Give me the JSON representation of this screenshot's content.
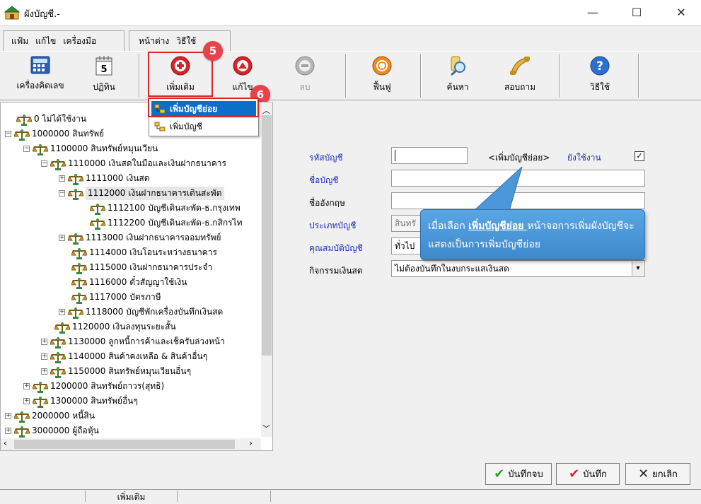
{
  "window": {
    "title": "ผังบัญชี.-",
    "controls": {
      "minimize": "—",
      "maximize": "☐",
      "close": "✕"
    }
  },
  "menu": {
    "group1": [
      "แฟ้ม",
      "แก้ไข",
      "เครื่องมือ"
    ],
    "group2": [
      "หน้าต่าง",
      "วิธีใช้"
    ]
  },
  "toolbar": {
    "calculator": "เครื่องคิดเลข",
    "calendar": "ปฏิทิน",
    "calendar_day": "5",
    "add": "เพิ่มเติม",
    "edit": "แก้ไข",
    "delete": "ลบ",
    "refresh": "ฟื้นฟู",
    "search": "ค้นหา",
    "inquiry": "สอบถาม",
    "help": "วิธีใช้"
  },
  "badges": {
    "step5": "5",
    "step6": "6"
  },
  "dropdown": {
    "items": [
      "เพิ่มบัญชีย่อย",
      "เพิ่มบัญชี"
    ]
  },
  "tree": {
    "items": [
      "0 ไม่ได้ใช้งาน",
      "1000000 สินทรัพย์",
      "1100000 สินทรัพย์หมุนเวียน",
      "1110000 เงินสดในมือและเงินฝากธนาคาร",
      "1111000 เงินสด",
      "1112000 เงินฝากธนาคารเดินสะพัด",
      "1112100 บัญชีเดินสะพัด-ธ.กรุงเทพ",
      "1112200 บัญชีเดินสะพัด-ธ.กสิกรไท",
      "1113000 เงินฝากธนาคารออมทรัพย์",
      "1114000 เงินโอนระหว่างธนาคาร",
      "1115000 เงินฝากธนาคารประจำ",
      "1116000 ตั๋วสัญญาใช้เงิน",
      "1117000 บัตรภาษี",
      "1118000 บัญชีพักเครื่องบันทึกเงินสด",
      "1120000 เงินลงทุนระยะสั้น",
      "1130000 ลูกหนี้การค้าและเช็ครับล่วงหน้า",
      "1140000 สินค้าคงเหลือ & สินค้าอื่นๆ",
      "1150000 สินทรัพย์หมุนเวียนอื่นๆ",
      "1200000 สินทรัพย์ถาวร(สุทธิ)",
      "1300000 สินทรัพย์อื่นๆ",
      "2000000 หนี้สิน",
      "3000000 ผู้ถือหุ้น"
    ],
    "expand_minus": "−",
    "expand_plus": "+"
  },
  "form": {
    "account_code_label": "รหัสบัญชี",
    "account_code_value": "",
    "sub_account_tag": "<เพิ่มบัญชีย่อย>",
    "still_used_label": "ยังใช้งาน",
    "still_used_check": "✓",
    "account_name_label": "ชื่อบัญชี",
    "english_name_label": "ชื่ออังกฤษ",
    "account_type_label": "ประเภทบัญชี",
    "account_type_value": "สินทรั",
    "account_property_label": "คุณสมบัติบัญชี",
    "account_property_value": "ทั่วไป",
    "cash_activity_label": "กิจกรรมเงินสด",
    "cash_activity_value": "ไม่ต้องบันทึกในงบกระแสเงินสด"
  },
  "callout": {
    "prefix": "เมื่อเลือก ",
    "highlight": "เพิ่มบัญชีย่อย ",
    "suffix": "หน้าจอการเพิ่มผังบัญชีจะแสดงเป็นการเพิ่มบัญชีย่อย"
  },
  "buttons": {
    "save_close": "บันทึกจบ",
    "save": "บันทึก",
    "cancel": "ยกเลิก"
  },
  "status": {
    "mode": "เพิ่มเติม"
  }
}
